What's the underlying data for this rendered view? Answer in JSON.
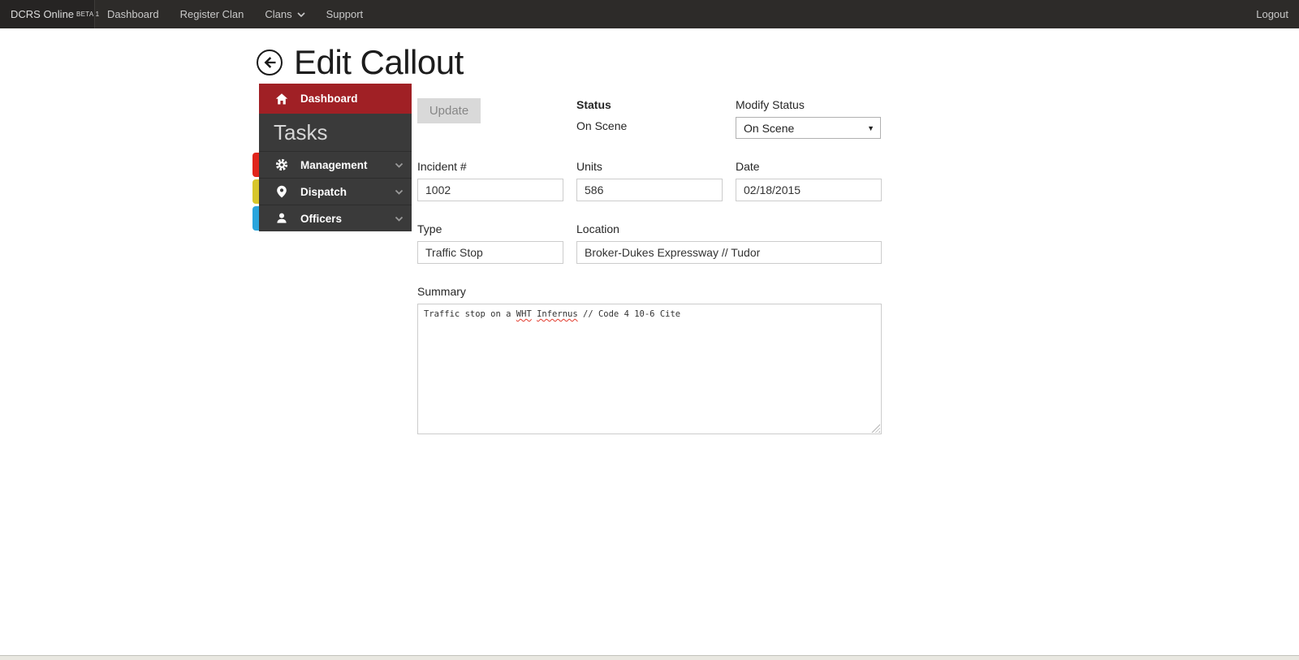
{
  "navbar": {
    "brand": "DCRS Online",
    "brand_badge": "BETA 1",
    "links": [
      {
        "label": "Dashboard"
      },
      {
        "label": "Register Clan"
      },
      {
        "label": "Clans"
      },
      {
        "label": "Support"
      }
    ],
    "logout": "Logout"
  },
  "page": {
    "title": "Edit Callout"
  },
  "sidebar": {
    "dashboard": {
      "label": "Dashboard",
      "bg": "#a02025"
    },
    "section_header": "Tasks",
    "items": [
      {
        "label": "Management",
        "icon": "gear-icon",
        "tab_color": "#e0251c"
      },
      {
        "label": "Dispatch",
        "icon": "map-pin-icon",
        "tab_color": "#d7c62b"
      },
      {
        "label": "Officers",
        "icon": "person-icon",
        "tab_color": "#29a5dd"
      }
    ]
  },
  "form": {
    "update_button": "Update",
    "status": {
      "label": "Status",
      "value": "On Scene"
    },
    "modify_status": {
      "label": "Modify Status",
      "value": "On Scene"
    },
    "incident_number": {
      "label": "Incident #",
      "value": "1002"
    },
    "units": {
      "label": "Units",
      "value": "586"
    },
    "date": {
      "label": "Date",
      "value": "02/18/2015"
    },
    "type": {
      "label": "Type",
      "value": "Traffic Stop"
    },
    "location": {
      "label": "Location",
      "value": "Broker-Dukes Expressway // Tudor"
    },
    "summary": {
      "label": "Summary",
      "value": "Traffic stop on a WHT Infernus // Code 4 10-6 Cite",
      "misspelled_words": [
        "WHT",
        "Infernus"
      ]
    }
  },
  "colors": {
    "navbar_bg": "#2d2b29",
    "sidebar_bg": "#3a3a3a",
    "active_red": "#a02025",
    "footer_bg": "#e9e8e1"
  }
}
